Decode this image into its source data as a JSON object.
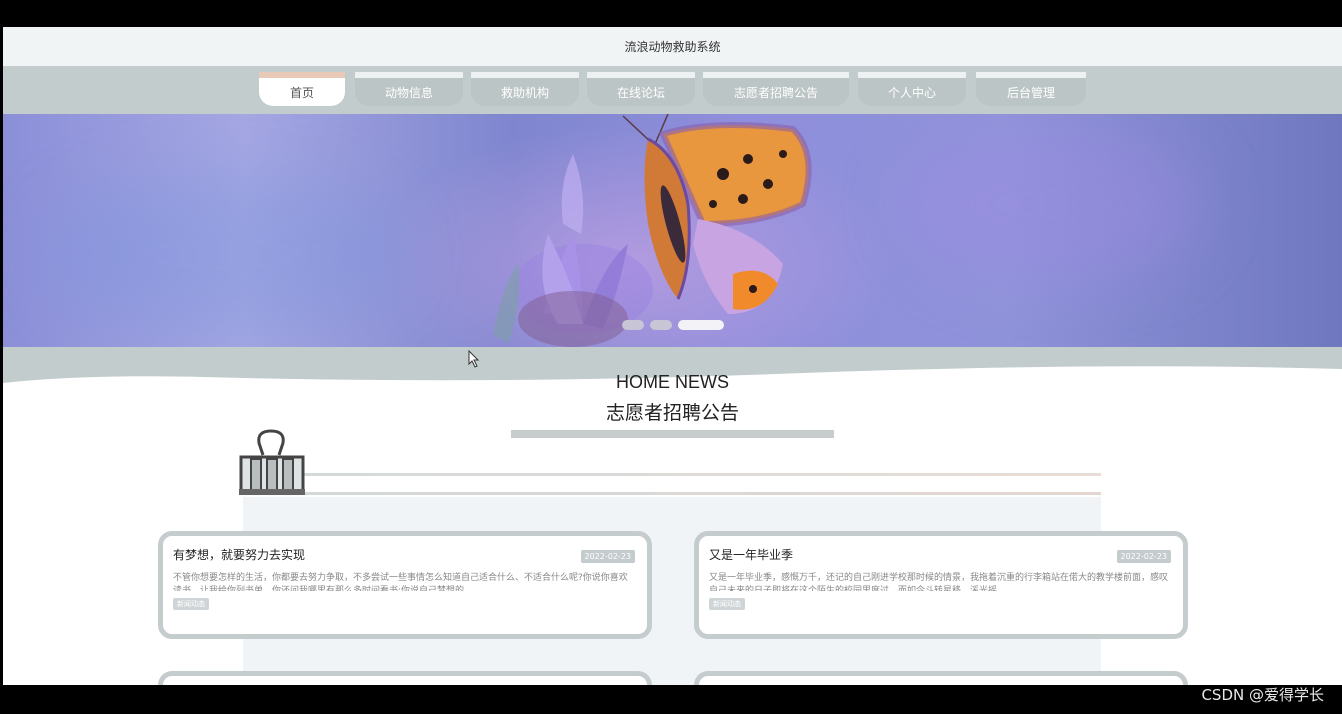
{
  "header": {
    "title": "流浪动物救助系统"
  },
  "nav": {
    "items": [
      {
        "label": "首页",
        "active": true
      },
      {
        "label": "动物信息"
      },
      {
        "label": "救助机构"
      },
      {
        "label": "在线论坛"
      },
      {
        "label": "志愿者招聘公告"
      },
      {
        "label": "个人中心"
      },
      {
        "label": "后台管理"
      }
    ]
  },
  "carousel": {
    "slides": 3,
    "active_index": 2
  },
  "section": {
    "heading_en": "HOME NEWS",
    "heading_cn": "志愿者招聘公告"
  },
  "news": [
    {
      "title": "有梦想，就要努力去实现",
      "date": "2022-02-23",
      "desc": "不管你想要怎样的生活，你都要去努力争取，不多尝试一些事情怎么知道自己适合什么、不适合什么呢?你说你喜欢读书，让我给你列书单，你还问我哪里有那么多时间看书;你说自己梦想的",
      "tag": "新闻动态"
    },
    {
      "title": "又是一年毕业季",
      "date": "2022-02-23",
      "desc": "又是一年毕业季，感慨万千，还记的自己刚进学校那时候的情景，我拖着沉重的行李箱站在偌大的教学楼前面，感叹自己未来的日子即将在这个陌生的校园里度过，而如今斗转星移，溪光摇",
      "tag": "新闻动态"
    }
  ],
  "watermark": "CSDN @爱得学长",
  "colors": {
    "nav_bg": "#c2cccd",
    "card_border": "#c4ccce",
    "active_tab_top": "#e8c9b8"
  }
}
